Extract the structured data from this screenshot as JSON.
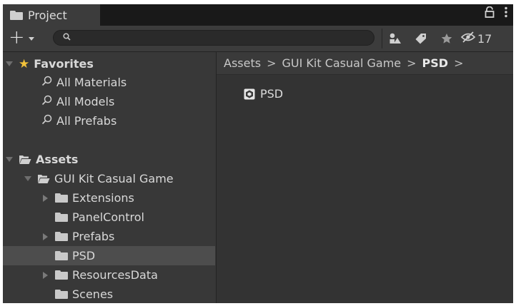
{
  "tab": {
    "title": "Project",
    "icon": "folder-icon"
  },
  "tab_actions": {
    "lock_icon": "lock-icon",
    "menu_icon": "kebab-menu-icon"
  },
  "toolbar": {
    "add_label": "+",
    "search_placeholder": "",
    "hidden_count": "17",
    "icons": [
      "search-by-type-icon",
      "search-by-label-icon",
      "favorite-icon",
      "hidden-packages-icon"
    ]
  },
  "tree": {
    "favorites": {
      "label": "Favorites",
      "items": [
        "All Materials",
        "All Models",
        "All Prefabs"
      ]
    },
    "assets": {
      "label": "Assets",
      "root": "GUI Kit Casual Game",
      "children": [
        {
          "label": "Extensions",
          "expandable": true
        },
        {
          "label": "PanelControl",
          "expandable": false
        },
        {
          "label": "Prefabs",
          "expandable": true
        },
        {
          "label": "PSD",
          "expandable": false,
          "selected": true
        },
        {
          "label": "ResourcesData",
          "expandable": true
        },
        {
          "label": "Scenes",
          "expandable": false
        }
      ]
    }
  },
  "breadcrumb": {
    "parts": [
      "Assets",
      "GUI Kit Casual Game"
    ],
    "current": "PSD"
  },
  "content": {
    "items": [
      {
        "label": "PSD",
        "icon": "psd-file-icon"
      }
    ]
  },
  "colors": {
    "panel_bg": "#383838",
    "content_bg": "#333333",
    "selected_row": "#4d4d4d",
    "favorites_star": "#f2c23a"
  }
}
